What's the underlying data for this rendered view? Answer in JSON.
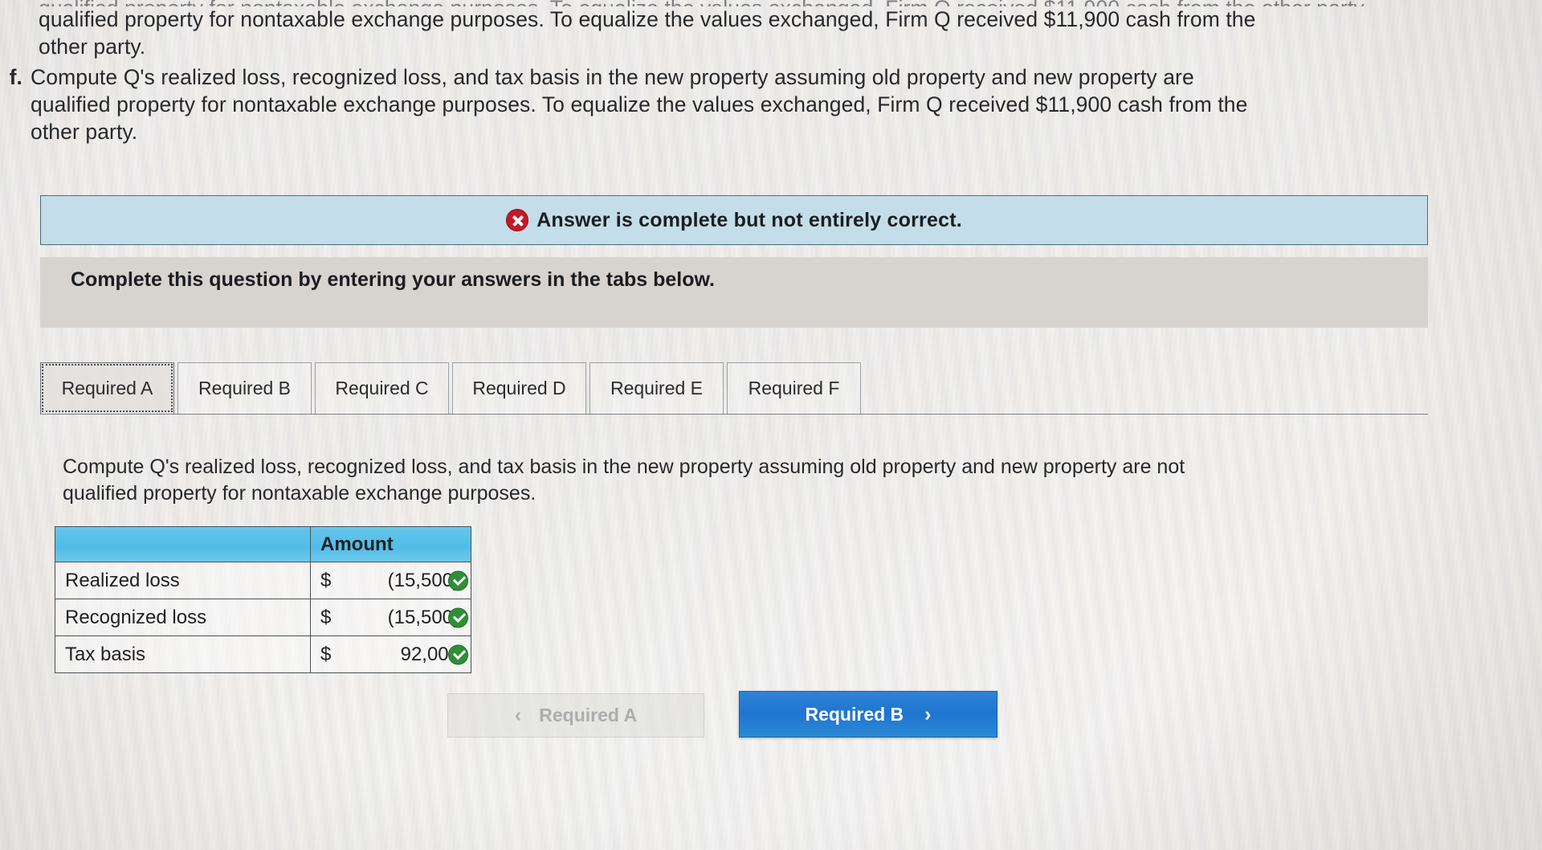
{
  "question": {
    "clipped_top_line": "qualified property for nontaxable exchange purposes. To equalize the values exchanged, Firm Q received $11,900 cash from the other party.",
    "line_1": "qualified property for nontaxable exchange purposes. To equalize the values exchanged, Firm Q received $11,900 cash from the",
    "line_2": "other party.",
    "item_f": {
      "marker": "f.",
      "line_1": "Compute Q's realized loss, recognized loss, and tax basis in the new property assuming old property and new property are",
      "line_2": "qualified property for nontaxable exchange purposes. To equalize the values exchanged, Firm Q received $11,900 cash from the",
      "line_3": "other party."
    }
  },
  "banner": {
    "icon": "x-circle-icon",
    "text": "Answer is complete but not entirely correct.",
    "bg_color": "#c3dde9",
    "icon_color": "#c61825"
  },
  "instruction": {
    "text": "Complete this question by entering your answers in the tabs below."
  },
  "tabs": [
    {
      "label": "Required A",
      "active": true
    },
    {
      "label": "Required B",
      "active": false
    },
    {
      "label": "Required C",
      "active": false
    },
    {
      "label": "Required D",
      "active": false
    },
    {
      "label": "Required E",
      "active": false
    },
    {
      "label": "Required F",
      "active": false
    }
  ],
  "subprompt": {
    "line_1": "Compute Q's realized loss, recognized loss, and tax basis in the new property assuming old property and new property are not",
    "line_2": "qualified property for nontaxable exchange purposes."
  },
  "answer_table": {
    "header": {
      "label": "",
      "amount": "Amount"
    },
    "header_color": "#52bce6",
    "rows": [
      {
        "label": "Realized loss",
        "currency": "$",
        "value": "(15,500)",
        "status": "correct-check-icon"
      },
      {
        "label": "Recognized loss",
        "currency": "$",
        "value": "(15,500)",
        "status": "correct-check-icon"
      },
      {
        "label": "Tax basis",
        "currency": "$",
        "value": "92,000",
        "status": "correct-check-icon"
      }
    ],
    "status_color": "#2f8f37"
  },
  "nav": {
    "prev": {
      "chevron": "‹",
      "label": "Required A",
      "disabled": true
    },
    "next": {
      "chevron": "›",
      "label": "Required B",
      "accent": "#1f74cf"
    }
  }
}
